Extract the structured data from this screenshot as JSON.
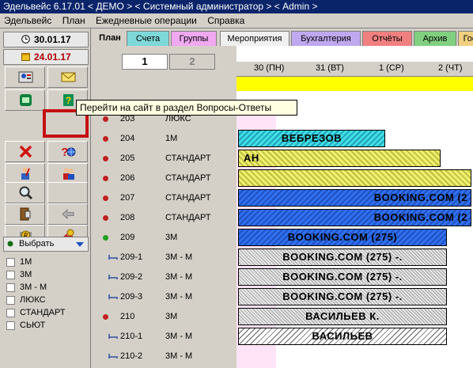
{
  "window": {
    "title": "Эдельвейс 6.17.01 < ДЕМО > < Системный администратор > < Admin >"
  },
  "menu": [
    "Эдельвейс",
    "План",
    "Ежедневные операции",
    "Справка"
  ],
  "left": {
    "date_today": "30.01.17",
    "date_other": "24.01.17",
    "select_label": "Выбрать",
    "filters": [
      "1М",
      "3М",
      "3М - М",
      "ЛЮКС",
      "СТАНДАРТ",
      "СЬЮТ"
    ]
  },
  "tabs": [
    "План",
    "Счета",
    "Группы",
    "Мероприятия",
    "Бухгалтерия",
    "Отчёты",
    "Архив",
    "Гос"
  ],
  "paging": [
    "1",
    "2"
  ],
  "days": [
    "30 (ПН)",
    "31 (ВТ)",
    "1 (СР)",
    "2 (ЧТ)"
  ],
  "tooltip": "Перейти на сайт в раздел  Вопросы-Ответы",
  "rows": [
    {
      "num": "203",
      "type": "ЛЮКС",
      "bar": ""
    },
    {
      "num": "204",
      "type": "1М",
      "bar": "ВЕБРЕЗОВ"
    },
    {
      "num": "205",
      "type": "СТАНДАРТ",
      "bar": "АН"
    },
    {
      "num": "206",
      "type": "СТАНДАРТ",
      "bar": ""
    },
    {
      "num": "207",
      "type": "СТАНДАРТ",
      "bar": "BOOKING.COM (2"
    },
    {
      "num": "208",
      "type": "СТАНДАРТ",
      "bar": "BOOKING.COM (2"
    },
    {
      "num": "209",
      "type": "3М",
      "bar": "BOOKING.COM (275)"
    },
    {
      "num": "209-1",
      "type": "3М - М",
      "bar": "BOOKING.COM (275) -."
    },
    {
      "num": "209-2",
      "type": "3М - М",
      "bar": "BOOKING.COM (275) -."
    },
    {
      "num": "209-3",
      "type": "3М - М",
      "bar": "BOOKING.COM (275) -."
    },
    {
      "num": "210",
      "type": "3М",
      "bar": "ВАСИЛЬЕВ К."
    },
    {
      "num": "210-1",
      "type": "3М - М",
      "bar": "ВАСИЛЬЕВ"
    },
    {
      "num": "210-2",
      "type": "3М - М",
      "bar": ""
    }
  ]
}
